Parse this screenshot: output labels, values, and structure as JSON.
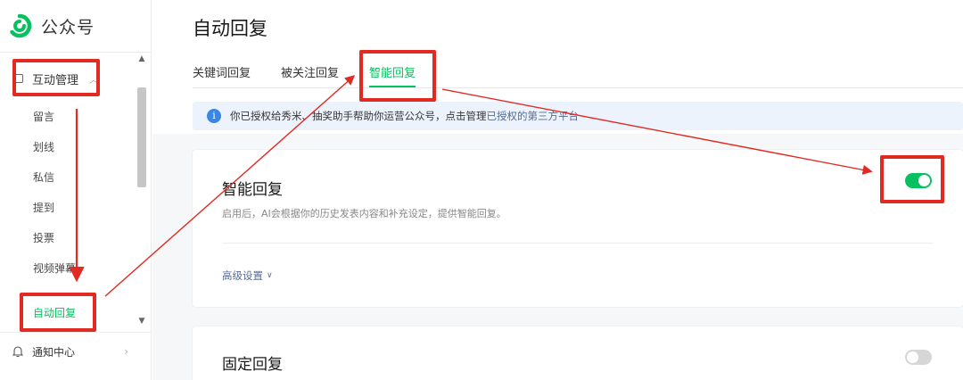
{
  "brand": {
    "name": "公众号",
    "color": "#07c160",
    "logo_icon": "wechat-mp-logo-icon"
  },
  "sidebar": {
    "group": {
      "label": "互动管理",
      "icon": "chat-bubble-icon",
      "chevron": "chevron-up-icon"
    },
    "items": [
      {
        "label": "留言"
      },
      {
        "label": "划线"
      },
      {
        "label": "私信"
      },
      {
        "label": "提到"
      },
      {
        "label": "投票"
      },
      {
        "label": "视频弹幕"
      },
      {
        "label": "自动回复",
        "active": true
      }
    ],
    "notify": {
      "label": "通知中心",
      "icon": "bell-icon",
      "chevron": "chevron-right-icon"
    }
  },
  "page": {
    "title": "自动回复"
  },
  "tabs": [
    {
      "label": "关键词回复"
    },
    {
      "label": "被关注回复"
    },
    {
      "label": "智能回复",
      "active": true
    }
  ],
  "info_bar": {
    "icon": "info-icon",
    "text": "你已授权给秀米、抽奖助手帮助你运营公众号，点击管理",
    "link": "已授权的第三方平台"
  },
  "smart_reply": {
    "title": "智能回复",
    "description": "启用后，AI会根据你的历史发表内容和补充设定，提供智能回复。",
    "advanced": "高级设置",
    "enabled": true
  },
  "fixed_reply": {
    "title": "固定回复",
    "enabled": false
  },
  "colors": {
    "accent": "#07c160",
    "annotation": "#e02a22",
    "link": "#576b95",
    "info_bg": "#edf3fc"
  }
}
